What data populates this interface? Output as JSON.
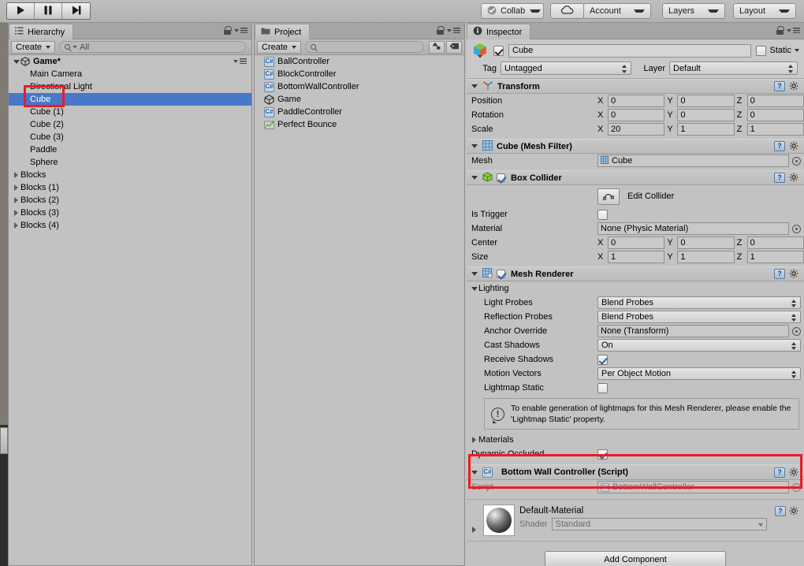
{
  "toolbar": {
    "play_icon": "play-icon",
    "pause_icon": "pause-icon",
    "step_icon": "step-icon",
    "collab_label": "Collab",
    "cloud_icon": "cloud-icon",
    "account_label": "Account",
    "layers_label": "Layers",
    "layout_label": "Layout"
  },
  "hierarchy": {
    "tab_label": "Hierarchy",
    "create_label": "Create",
    "search_placeholder": "All",
    "scene_name": "Game*",
    "items": [
      {
        "label": "Main Camera",
        "indent": 1,
        "expandable": false,
        "selected": false
      },
      {
        "label": "Directional Light",
        "indent": 1,
        "expandable": false,
        "selected": false
      },
      {
        "label": "Cube",
        "indent": 1,
        "expandable": false,
        "selected": true
      },
      {
        "label": "Cube (1)",
        "indent": 1,
        "expandable": false,
        "selected": false
      },
      {
        "label": "Cube (2)",
        "indent": 1,
        "expandable": false,
        "selected": false
      },
      {
        "label": "Cube (3)",
        "indent": 1,
        "expandable": false,
        "selected": false
      },
      {
        "label": "Paddle",
        "indent": 1,
        "expandable": false,
        "selected": false
      },
      {
        "label": "Sphere",
        "indent": 1,
        "expandable": false,
        "selected": false
      },
      {
        "label": "Blocks",
        "indent": 0,
        "expandable": true,
        "selected": false
      },
      {
        "label": "Blocks (1)",
        "indent": 0,
        "expandable": true,
        "selected": false
      },
      {
        "label": "Blocks (2)",
        "indent": 0,
        "expandable": true,
        "selected": false
      },
      {
        "label": "Blocks (3)",
        "indent": 0,
        "expandable": true,
        "selected": false
      },
      {
        "label": "Blocks (4)",
        "indent": 0,
        "expandable": true,
        "selected": false
      }
    ]
  },
  "project": {
    "tab_label": "Project",
    "create_label": "Create",
    "search_placeholder": "",
    "items": [
      {
        "label": "BallController",
        "icon": "csharp-script-icon"
      },
      {
        "label": "BlockController",
        "icon": "csharp-script-icon"
      },
      {
        "label": "BottomWallController",
        "icon": "csharp-script-icon"
      },
      {
        "label": "Game",
        "icon": "unity-scene-icon"
      },
      {
        "label": "PaddleController",
        "icon": "csharp-script-icon"
      },
      {
        "label": "Perfect Bounce",
        "icon": "physic-material-icon"
      }
    ]
  },
  "inspector": {
    "tab_label": "Inspector",
    "object_name": "Cube",
    "object_enabled": true,
    "static_label": "Static",
    "static_checked": false,
    "tag_label": "Tag",
    "tag_value": "Untagged",
    "layer_label": "Layer",
    "layer_value": "Default",
    "transform": {
      "title": "Transform",
      "position_label": "Position",
      "rotation_label": "Rotation",
      "scale_label": "Scale",
      "axes": [
        "X",
        "Y",
        "Z"
      ],
      "position": [
        "0",
        "0",
        "0"
      ],
      "rotation": [
        "0",
        "0",
        "0"
      ],
      "scale": [
        "20",
        "1",
        "1"
      ]
    },
    "mesh_filter": {
      "title": "Cube (Mesh Filter)",
      "mesh_label": "Mesh",
      "mesh_value": "Cube"
    },
    "box_collider": {
      "title": "Box Collider",
      "enabled": true,
      "edit_collider_label": "Edit Collider",
      "is_trigger_label": "Is Trigger",
      "is_trigger_checked": false,
      "material_label": "Material",
      "material_value": "None (Physic Material)",
      "center_label": "Center",
      "center": [
        "0",
        "0",
        "0"
      ],
      "size_label": "Size",
      "size": [
        "1",
        "1",
        "1"
      ]
    },
    "mesh_renderer": {
      "title": "Mesh Renderer",
      "enabled": true,
      "lighting_label": "Lighting",
      "light_probes_label": "Light Probes",
      "light_probes_value": "Blend Probes",
      "reflection_probes_label": "Reflection Probes",
      "reflection_probes_value": "Blend Probes",
      "anchor_override_label": "Anchor Override",
      "anchor_override_value": "None (Transform)",
      "cast_shadows_label": "Cast Shadows",
      "cast_shadows_value": "On",
      "receive_shadows_label": "Receive Shadows",
      "receive_shadows_checked": true,
      "motion_vectors_label": "Motion Vectors",
      "motion_vectors_value": "Per Object Motion",
      "lightmap_static_label": "Lightmap Static",
      "lightmap_static_checked": false,
      "info_text": "To enable generation of lightmaps for this Mesh Renderer, please enable the 'Lightmap Static' property.",
      "materials_label": "Materials",
      "dynamic_occluded_label": "Dynamic Occluded",
      "dynamic_occluded_checked": true
    },
    "script_component": {
      "title": "Bottom Wall Controller (Script)",
      "script_label": "Script",
      "script_value": "BottomWallController"
    },
    "material_preview": {
      "name": "Default-Material",
      "shader_label": "Shader",
      "shader_value": "Standard"
    },
    "add_component_label": "Add Component"
  },
  "highlight_color": "#ed1c24",
  "selection_color": "#4878c8"
}
